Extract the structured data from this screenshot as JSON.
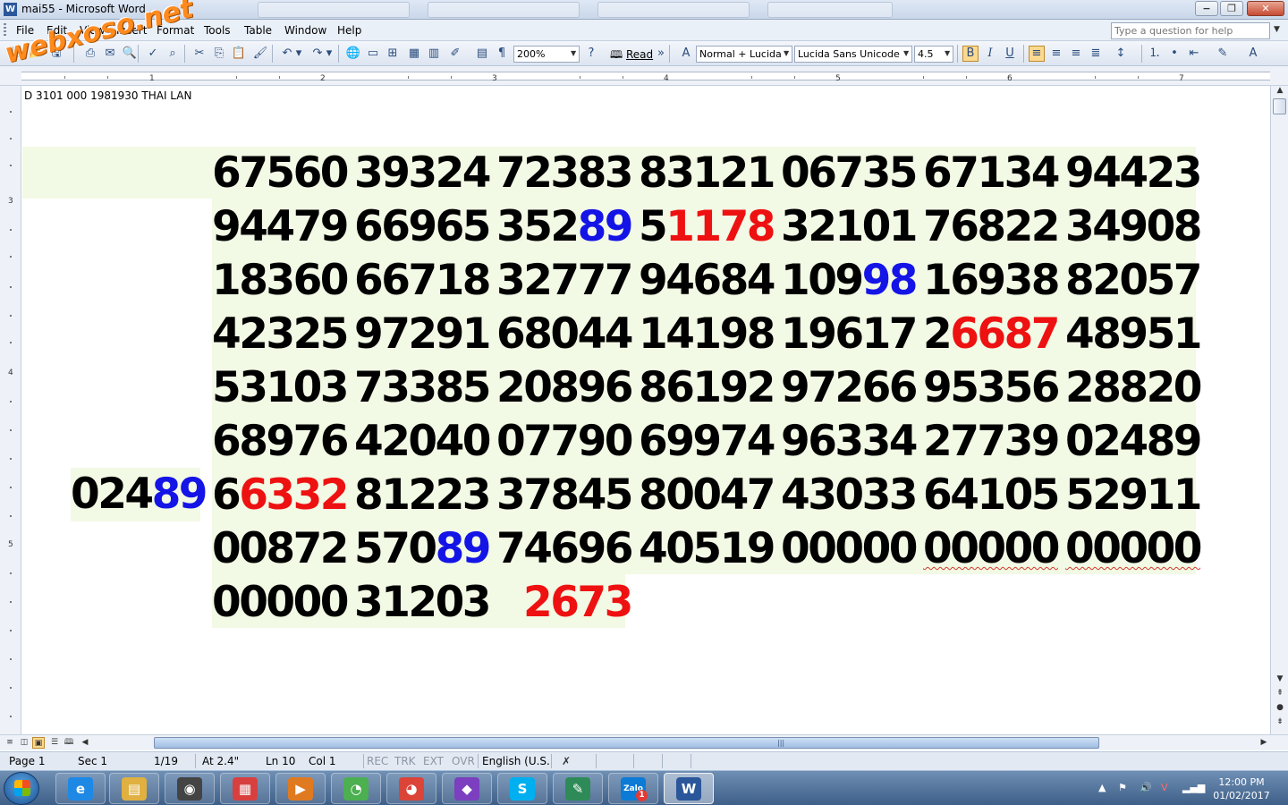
{
  "window": {
    "title": "mai55 - Microsoft Word",
    "app_icon": "W",
    "minimize": "−",
    "maximize": "❐",
    "close": "✕"
  },
  "watermark": "webxoso.net",
  "menu": [
    "File",
    "Edit",
    "View",
    "Insert",
    "Format",
    "Tools",
    "Table",
    "Window",
    "Help"
  ],
  "help_search": {
    "placeholder": "Type a question for help"
  },
  "toolbar": {
    "zoom": "200%",
    "read_label": "Read",
    "style": "Normal + Lucida",
    "font": "Lucida Sans Unicode",
    "size": "4.5",
    "bold": "B",
    "italic": "I",
    "underline": "U"
  },
  "ruler": [
    "1",
    "2",
    "3",
    "4",
    "5",
    "6",
    "7"
  ],
  "vruler": [
    "3",
    "4",
    "5"
  ],
  "document": {
    "header_text": "D 3101 000 1981930 THAI LAN",
    "side_number": {
      "prefix": "024",
      "highlight": "89",
      "highlight_color": "#1414e6"
    },
    "special_number": "2673",
    "rows": [
      [
        "67560",
        "39324",
        "72383",
        "83121",
        "06735",
        "67134",
        "94423"
      ],
      [
        "94479",
        "66965",
        "35289",
        "51178",
        "32101",
        "76822",
        "34908"
      ],
      [
        "18360",
        "66718",
        "32777",
        "94684",
        "10998",
        "16938",
        "82057"
      ],
      [
        "42325",
        "97291",
        "68044",
        "14198",
        "19617",
        "26687",
        "48951"
      ],
      [
        "53103",
        "73385",
        "20896",
        "86192",
        "97266",
        "95356",
        "28820"
      ],
      [
        "68976",
        "42040",
        "07790",
        "69974",
        "96334",
        "27739",
        "02489"
      ],
      [
        "66332",
        "81223",
        "37845",
        "80047",
        "43033",
        "64105",
        "52911"
      ],
      [
        "00872",
        "57089",
        "74696",
        "40519",
        "00000",
        "00000",
        "00000"
      ],
      [
        "00000",
        "31203"
      ]
    ],
    "highlights": [
      {
        "row": 1,
        "col": 2,
        "start": 3,
        "color": "blue"
      },
      {
        "row": 1,
        "col": 3,
        "start": 1,
        "color": "red"
      },
      {
        "row": 2,
        "col": 4,
        "start": 3,
        "color": "blue"
      },
      {
        "row": 3,
        "col": 5,
        "start": 1,
        "color": "red"
      },
      {
        "row": 6,
        "col": 0,
        "start": 1,
        "color": "red"
      },
      {
        "row": 7,
        "col": 1,
        "start": 3,
        "color": "blue"
      }
    ],
    "spellcheck_squiggle": [
      [
        7,
        5
      ],
      [
        7,
        6
      ]
    ],
    "colors": {
      "blue": "#1414e6",
      "red": "#ee1111",
      "band": "#f2f9e5"
    }
  },
  "statusbar": {
    "page": "Page  1",
    "sec": "Sec  1",
    "pages": "1/19",
    "at": "At  2.4\"",
    "ln": "Ln  10",
    "col": "Col  1",
    "rec": "REC",
    "trk": "TRK",
    "ext": "EXT",
    "ovr": "OVR",
    "language": "English (U.S."
  },
  "taskbar": {
    "apps": [
      {
        "name": "internet-explorer",
        "glyph": "e",
        "color": "#1e88e5"
      },
      {
        "name": "file-explorer",
        "glyph": "▤",
        "color": "#e0b040"
      },
      {
        "name": "camera-app",
        "glyph": "◉",
        "color": "#444444"
      },
      {
        "name": "paint-app",
        "glyph": "▦",
        "color": "#d84040"
      },
      {
        "name": "media-player",
        "glyph": "▶",
        "color": "#e07a20"
      },
      {
        "name": "coccoc-browser",
        "glyph": "◔",
        "color": "#4caf50"
      },
      {
        "name": "chrome-browser",
        "glyph": "◕",
        "color": "#db4437"
      },
      {
        "name": "visual-studio",
        "glyph": "◆",
        "color": "#7b3fbf"
      },
      {
        "name": "skype",
        "glyph": "S",
        "color": "#00aff0"
      },
      {
        "name": "feather-app",
        "glyph": "✎",
        "color": "#2e8b57"
      },
      {
        "name": "zalo",
        "glyph": "Zalo",
        "color": "#0b7bd6",
        "badge": "1"
      },
      {
        "name": "word",
        "glyph": "W",
        "color": "#2b579a"
      }
    ],
    "time": "12:00 PM",
    "date": "01/02/2017"
  }
}
